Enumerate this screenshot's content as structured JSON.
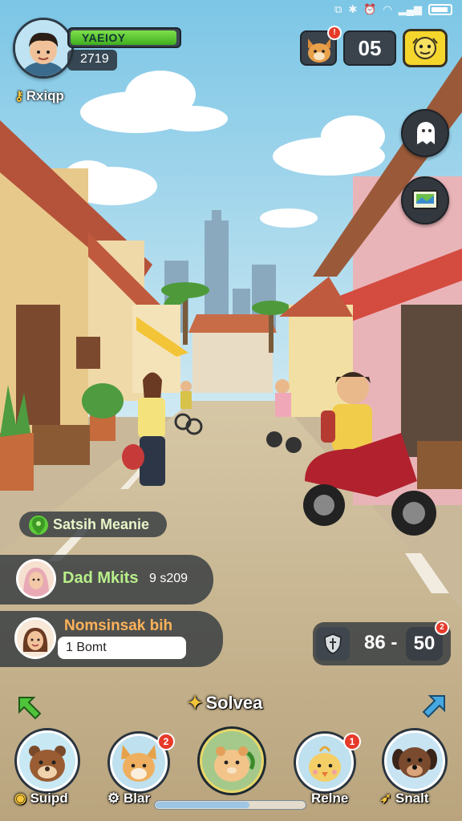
{
  "player": {
    "name": "YAEIOY",
    "score": "2719",
    "sub_label": "Rxiqp",
    "health_fraction": 0.96
  },
  "top_right": {
    "pet_badge": "!",
    "counter": "05"
  },
  "location": {
    "name": "Satsih Meanie"
  },
  "chat": {
    "message_1": "Dad Mkits",
    "message_1_time": "9 s209",
    "message_2_title": "Nomsinsak bih",
    "message_2_input": "1 Bomt"
  },
  "ratio": {
    "left": "86 -",
    "right": "50",
    "badge": "2"
  },
  "bottom": {
    "section_label": "Solvea",
    "characters": [
      {
        "label": "Suipd",
        "badge": ""
      },
      {
        "label": "Blar",
        "badge": "2"
      },
      {
        "label": "",
        "badge": ""
      },
      {
        "label": "Relne",
        "badge": "1"
      },
      {
        "label": "Snalt",
        "badge": ""
      }
    ],
    "progress_fraction": 0.62
  },
  "colors": {
    "sky": "#8fcfe8",
    "road": "#c8b58f",
    "health_green": "#5cc832",
    "accent_yellow": "#f5d62c",
    "badge_red": "#e63a2a"
  }
}
